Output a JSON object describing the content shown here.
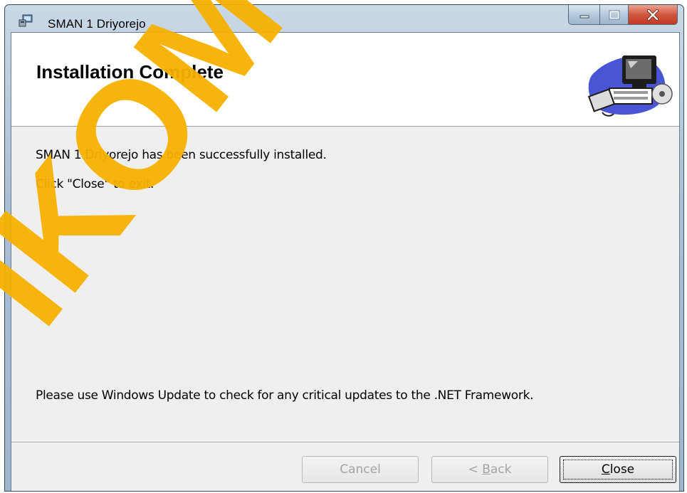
{
  "window": {
    "title": "SMAN 1 Driyorejo",
    "icon": "installer-icon",
    "caption_buttons": {
      "minimize": "minimize-icon",
      "maximize": "maximize-icon",
      "close": "close-icon"
    }
  },
  "banner": {
    "title": "Installation Complete",
    "art": "computer-cd-icon"
  },
  "body": {
    "line1": "SMAN 1 Driyorejo has been successfully installed.",
    "line2": "Click \"Close\" to exit.",
    "note": "Please use Windows Update to check for any critical updates to the .NET Framework."
  },
  "buttons": {
    "cancel": "Cancel",
    "back_prefix": "< ",
    "back_mnemonic": "B",
    "back_rest": "ack",
    "close_mnemonic": "C",
    "close_rest": "lose"
  },
  "watermark": {
    "text": "IKOM S",
    "color": "#f5b000"
  }
}
